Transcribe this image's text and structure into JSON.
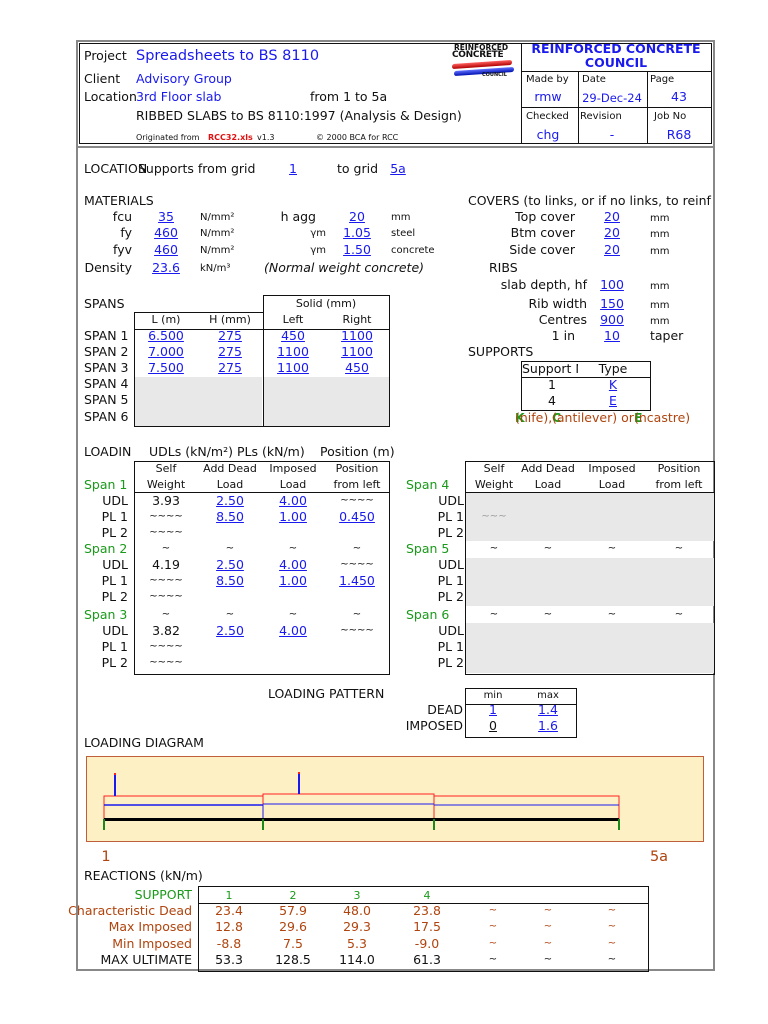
{
  "header": {
    "project_label": "Project",
    "project": "Spreadsheets to BS 8110",
    "client_label": "Client",
    "client": "Advisory Group",
    "location_label": "Location",
    "location": "3rd Floor slab",
    "range": "from 1 to 5a",
    "title": "RIBBED SLABS to BS 8110:1997 (Analysis & Design)",
    "originated_label": "Originated from",
    "file": "RCC32.xls",
    "version": "v1.3",
    "copyright": "© 2000 BCA for RCC",
    "logo_text": [
      "REINFORCED",
      "CONCRETE",
      "COUNCIL"
    ],
    "council_title_1": "REINFORCED CONCRETE",
    "council_title_2": "COUNCIL",
    "made_by_label": "Made by",
    "made_by": "rmw",
    "date_label": "Date",
    "date": "29-Dec-24",
    "page_label": "Page",
    "page": "43",
    "checked_label": "Checked",
    "checked": "chg",
    "revision_label": "Revision",
    "revision": "-",
    "job_no_label": "Job No",
    "job_no": "R68"
  },
  "location": {
    "label": "LOCATION",
    "supports_from": "Supports from grid",
    "from_grid": "1",
    "to_label": "to grid",
    "to_grid": "5a"
  },
  "materials": {
    "title": "MATERIALS",
    "fcu_label": "fcu",
    "fcu": "35",
    "fcu_unit": "N/mm²",
    "fy_label": "fy",
    "fy": "460",
    "fy_unit": "N/mm²",
    "fyv_label": "fyv",
    "fyv": "460",
    "fyv_unit": "N/mm²",
    "density_label": "Density",
    "density": "23.6",
    "density_unit": "kN/m³",
    "density_note": "(Normal weight concrete)",
    "hagg_label": "h agg",
    "hagg": "20",
    "hagg_unit": "mm",
    "gm_label": "γm",
    "gm_steel": "1.05",
    "steel_label": "steel",
    "gm_concrete": "1.50",
    "concrete_label": "concrete"
  },
  "covers": {
    "title": "COVERS (to links, or if no links, to reinf",
    "top_label": "Top cover",
    "top": "20",
    "btm_label": "Btm cover",
    "btm": "20",
    "side_label": "Side cover",
    "side": "20",
    "unit": "mm"
  },
  "ribs": {
    "title": "RIBS",
    "hf_label": "slab depth, hf",
    "hf": "100",
    "width_label": "Rib width",
    "width": "150",
    "centres_label": "Centres",
    "centres": "900",
    "taper_label": "1 in",
    "taper": "10",
    "taper_unit": "taper",
    "unit": "mm"
  },
  "supports": {
    "title": "SUPPORTS",
    "col_no": "Support No",
    "col_type": "Type",
    "rows": [
      {
        "no": "1",
        "type": "K"
      },
      {
        "no": "4",
        "type": "E"
      }
    ],
    "legend": [
      {
        "key": "K",
        "text": "(nife), "
      },
      {
        "key": "C",
        "text": "(antilever) or "
      },
      {
        "key": "E",
        "text": "(ncastre)"
      }
    ]
  },
  "spans": {
    "title": "SPANS",
    "solid_label": "Solid (mm)",
    "cols": [
      "L (m)",
      "H (mm)",
      "Left",
      "Right"
    ],
    "rows": [
      {
        "label": "SPAN 1",
        "values": [
          "6.500",
          "275",
          "450",
          "1100"
        ]
      },
      {
        "label": "SPAN 2",
        "values": [
          "7.000",
          "275",
          "1100",
          "1100"
        ]
      },
      {
        "label": "SPAN 3",
        "values": [
          "7.500",
          "275",
          "1100",
          "450"
        ]
      },
      {
        "label": "SPAN 4",
        "values": [
          "",
          "",
          "",
          ""
        ]
      },
      {
        "label": "SPAN 5",
        "values": [
          "",
          "",
          "",
          ""
        ]
      },
      {
        "label": "SPAN 6",
        "values": [
          "",
          "",
          "",
          ""
        ]
      }
    ]
  },
  "loading": {
    "title": "LOADIN",
    "udl_units": "UDLs (kN/m²)",
    "pl_units": "PLs (kN/m)",
    "pos_units": "Position (m)",
    "col_head": [
      [
        "Self",
        "Weight"
      ],
      [
        "Add Dead",
        "Load"
      ],
      [
        "Imposed",
        "Load"
      ],
      [
        "Position",
        "from left"
      ]
    ],
    "left": [
      {
        "span": "Span 1",
        "head": null,
        "rows": [
          {
            "label": "UDL",
            "cells": [
              "3.93",
              "2.50",
              "4.00",
              "~~~~"
            ]
          },
          {
            "label": "PL 1",
            "cells": [
              "~~~~",
              "8.50",
              "1.00",
              "0.450"
            ]
          },
          {
            "label": "PL 2",
            "cells": [
              "~~~~",
              "",
              "",
              ""
            ]
          }
        ]
      },
      {
        "span": "Span 2",
        "head": [
          "~",
          "~",
          "~",
          "~"
        ],
        "rows": [
          {
            "label": "UDL",
            "cells": [
              "4.19",
              "2.50",
              "4.00",
              "~~~~"
            ]
          },
          {
            "label": "PL 1",
            "cells": [
              "~~~~",
              "8.50",
              "1.00",
              "1.450"
            ]
          },
          {
            "label": "PL 2",
            "cells": [
              "~~~~",
              "",
              "",
              ""
            ]
          }
        ]
      },
      {
        "span": "Span 3",
        "head": [
          "~",
          "~",
          "~",
          "~"
        ],
        "rows": [
          {
            "label": "UDL",
            "cells": [
              "3.82",
              "2.50",
              "4.00",
              "~~~~"
            ]
          },
          {
            "label": "PL 1",
            "cells": [
              "~~~~",
              "",
              "",
              ""
            ]
          },
          {
            "label": "PL 2",
            "cells": [
              "~~~~",
              "",
              "",
              ""
            ]
          }
        ]
      }
    ],
    "right": [
      {
        "span": "Span 4",
        "head": null,
        "rows": [
          {
            "label": "UDL",
            "cells": [
              "",
              "",
              "",
              ""
            ]
          },
          {
            "label": "PL 1",
            "cells": [
              "~~~",
              "",
              "",
              ""
            ]
          },
          {
            "label": "PL 2",
            "cells": [
              "",
              "",
              "",
              ""
            ]
          }
        ]
      },
      {
        "span": "Span 5",
        "head": [
          "~",
          "~",
          "~",
          "~"
        ],
        "rows": [
          {
            "label": "UDL",
            "cells": [
              "",
              "",
              "",
              ""
            ]
          },
          {
            "label": "PL 1",
            "cells": [
              "",
              "",
              "",
              ""
            ]
          },
          {
            "label": "PL 2",
            "cells": [
              "",
              "",
              "",
              ""
            ]
          }
        ]
      },
      {
        "span": "Span 6",
        "head": [
          "~",
          "~",
          "~",
          "~"
        ],
        "rows": [
          {
            "label": "UDL",
            "cells": [
              "",
              "",
              "",
              ""
            ]
          },
          {
            "label": "PL 1",
            "cells": [
              "",
              "",
              "",
              ""
            ]
          },
          {
            "label": "PL 2",
            "cells": [
              "",
              "",
              "",
              ""
            ]
          }
        ]
      }
    ]
  },
  "pattern": {
    "title": "LOADING PATTERN",
    "min_label": "min",
    "max_label": "max",
    "dead_label": "DEAD",
    "dead_min": "1",
    "dead_max": "1.4",
    "imposed_label": "IMPOSED",
    "imposed_min": "0",
    "imposed_max": "1.6"
  },
  "diagram": {
    "title": "LOADING DIAGRAM",
    "start_label": "1",
    "end_label": "5a",
    "colors": {
      "beam": "#000000",
      "dead": "#ff2020",
      "imposed": "#1a1aee",
      "support": "#1a8a1a",
      "fill": "#fdf0c4"
    }
  },
  "reactions": {
    "title": "REACTIONS (kN/m)",
    "support_label": "SUPPORT",
    "supports": [
      "1",
      "2",
      "3",
      "4"
    ],
    "rows": [
      {
        "label": "Characteristic Dead",
        "values": [
          "23.4",
          "57.9",
          "48.0",
          "23.8",
          "~",
          "~",
          "~"
        ]
      },
      {
        "label": "Max Imposed",
        "values": [
          "12.8",
          "29.6",
          "29.3",
          "17.5",
          "~",
          "~",
          "~"
        ]
      },
      {
        "label": "Min Imposed",
        "values": [
          "-8.8",
          "7.5",
          "5.3",
          "-9.0",
          "~",
          "~",
          "~"
        ]
      },
      {
        "label": "MAX ULTIMATE",
        "values": [
          "53.3",
          "128.5",
          "114.0",
          "61.3",
          "~",
          "~",
          "~"
        ]
      }
    ]
  }
}
